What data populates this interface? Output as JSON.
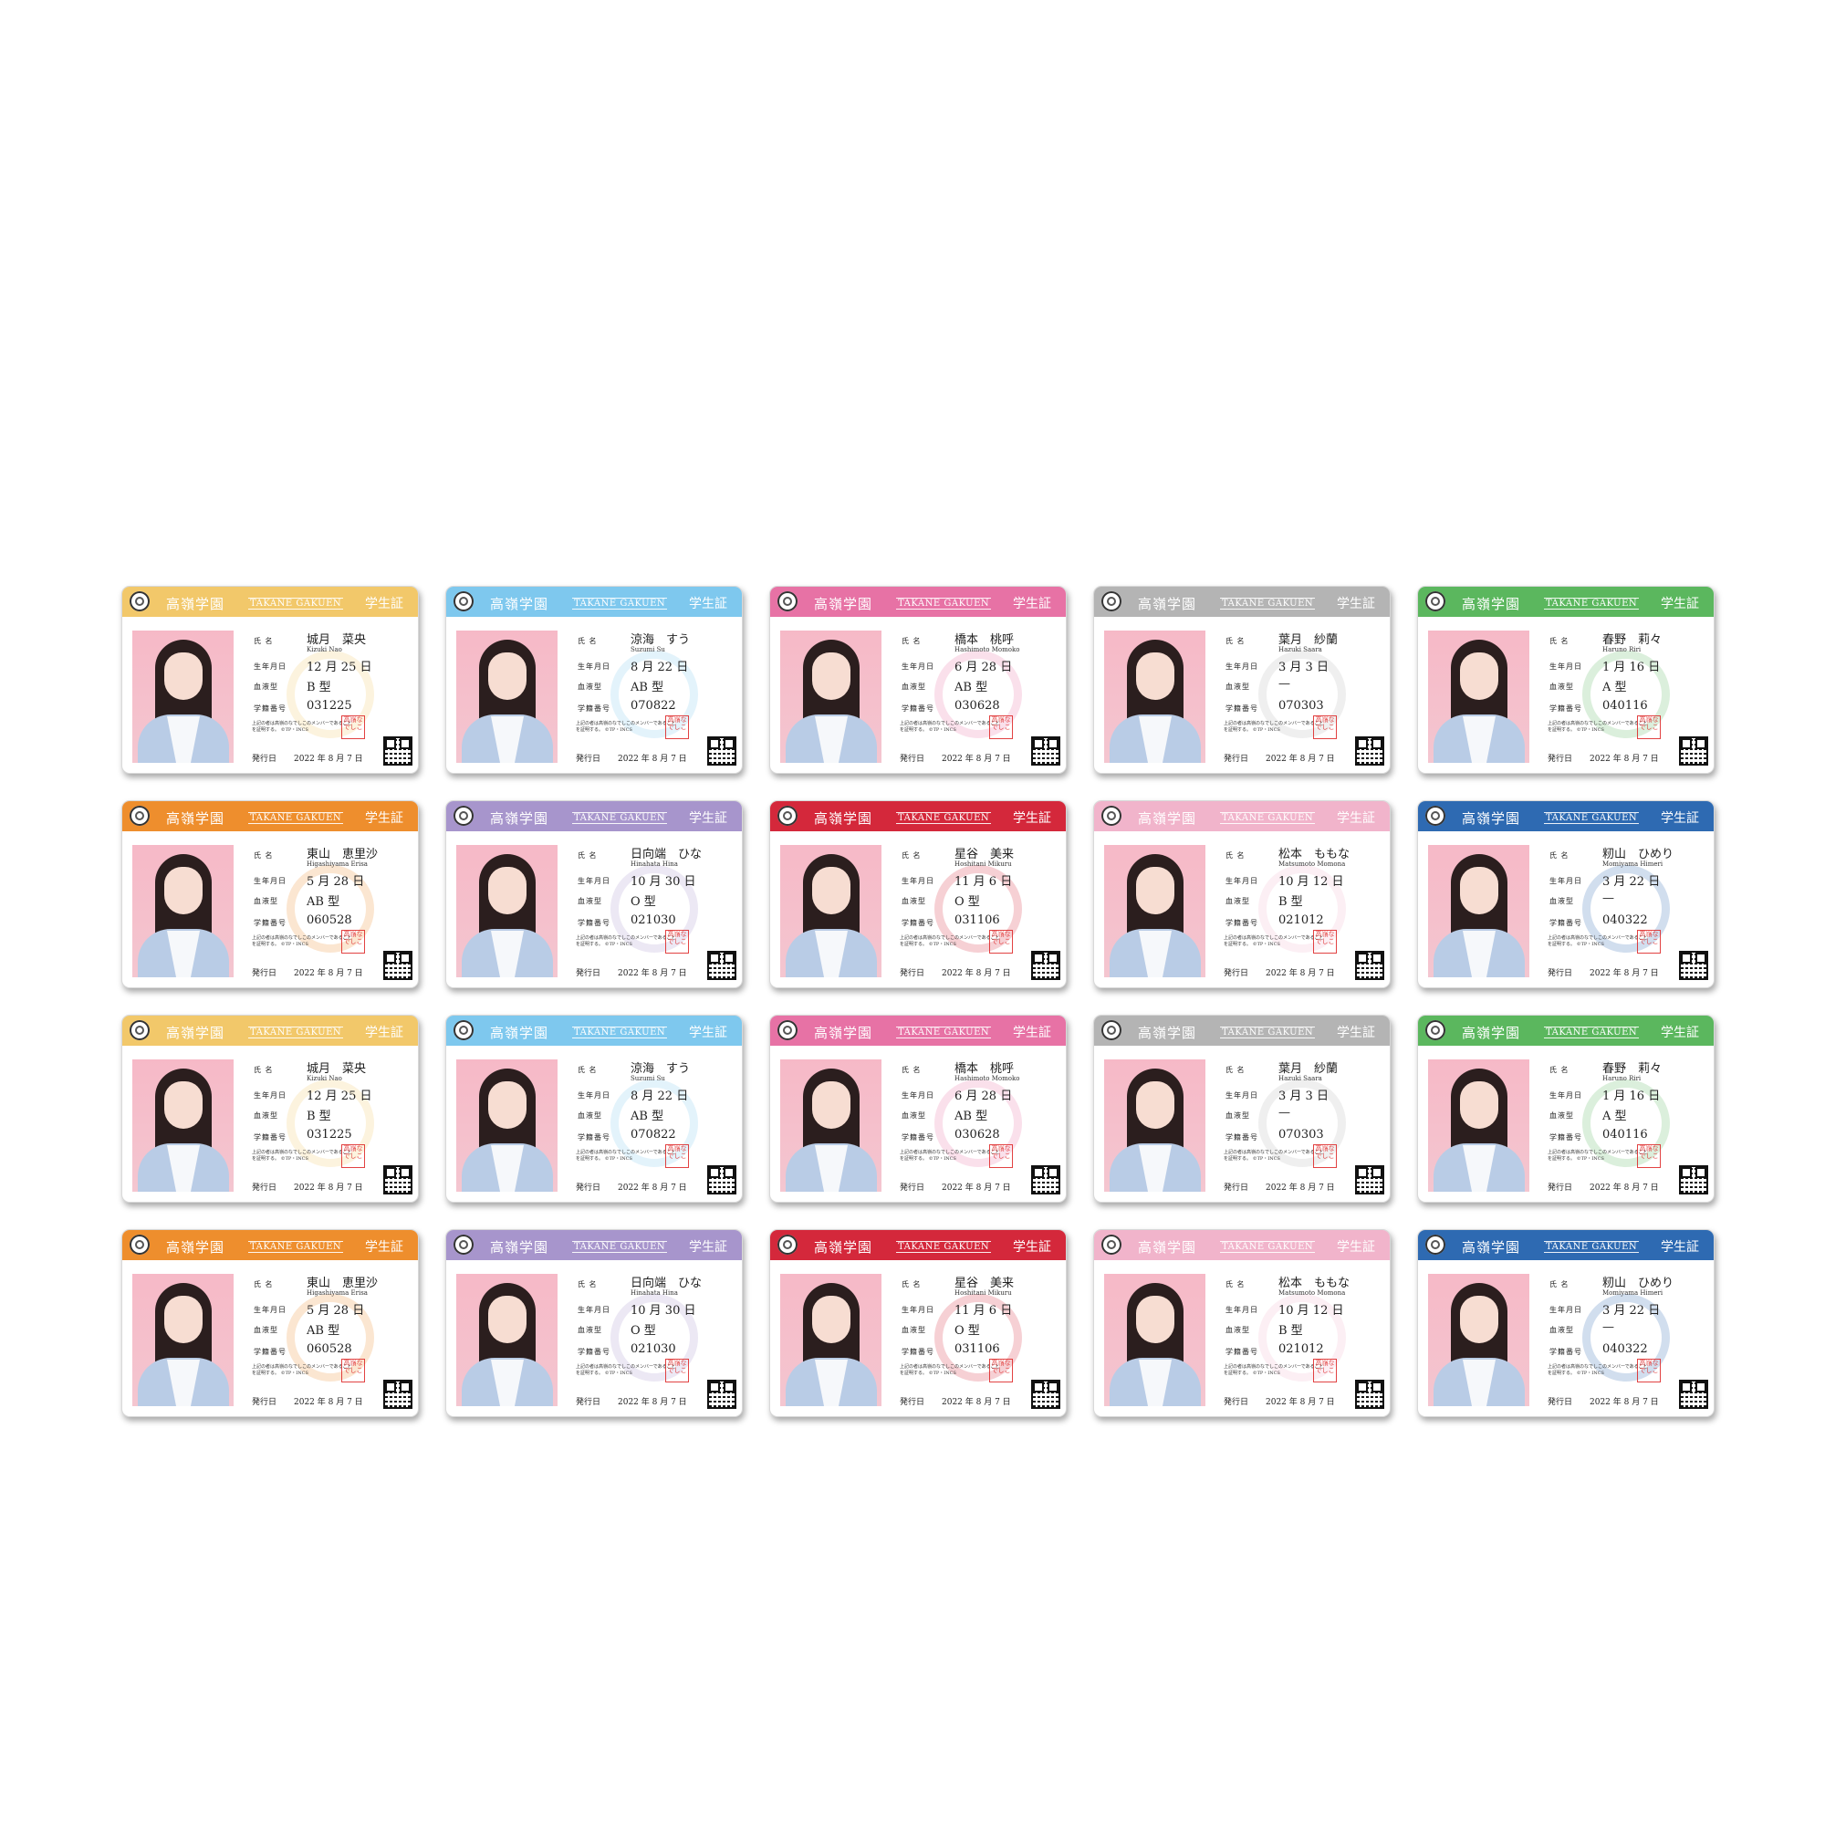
{
  "card_text": {
    "school": "高嶺学園",
    "school_roman": "TAKANE GAKUEN",
    "card_title": "学生証",
    "label_name": "氏 名",
    "label_birth": "生年月日",
    "label_blood": "血液型",
    "label_id": "学籍番号",
    "label_issue": "発行日",
    "issue_date": "2022 年 8 月 7 日",
    "note": "上記の者は高嶺のなでしこのメンバーであることを証明する。 ©TP・INCS",
    "stamp": "高嶺なでしこ"
  },
  "members": [
    {
      "name": "城月　菜央",
      "roman": "Kizuki Nao",
      "birth": "12 月 25 日",
      "blood": "B 型",
      "id": "031225",
      "color": "#f2c86a"
    },
    {
      "name": "涼海　すう",
      "roman": "Suzumi Su",
      "birth": "8 月 22 日",
      "blood": "AB 型",
      "id": "070822",
      "color": "#7ec8ee"
    },
    {
      "name": "橋本　桃呼",
      "roman": "Hashimoto Momoko",
      "birth": "6 月 28 日",
      "blood": "AB 型",
      "id": "030628",
      "color": "#e772a5"
    },
    {
      "name": "葉月　紗蘭",
      "roman": "Hazuki Saara",
      "birth": "3 月 3 日",
      "blood": "—",
      "id": "070303",
      "color": "#b4b4b4"
    },
    {
      "name": "春野　莉々",
      "roman": "Haruno Riri",
      "birth": "1 月 16 日",
      "blood": "A 型",
      "id": "040116",
      "color": "#5bb75e"
    },
    {
      "name": "東山　恵里沙",
      "roman": "Higashiyama Erisa",
      "birth": "5 月 28 日",
      "blood": "AB 型",
      "id": "060528",
      "color": "#ee8e2d"
    },
    {
      "name": "日向端　ひな",
      "roman": "Hinahata Hina",
      "birth": "10 月 30 日",
      "blood": "O 型",
      "id": "021030",
      "color": "#a795cc"
    },
    {
      "name": "星谷　美来",
      "roman": "Hoshitani Mikuru",
      "birth": "11 月 6 日",
      "blood": "O 型",
      "id": "031106",
      "color": "#d4283b"
    },
    {
      "name": "松本　ももな",
      "roman": "Matsumoto Momona",
      "birth": "10 月 12 日",
      "blood": "B 型",
      "id": "021012",
      "color": "#f1b4cb"
    },
    {
      "name": "籾山　ひめり",
      "roman": "Momiyama Himeri",
      "birth": "3 月 22 日",
      "blood": "—",
      "id": "040322",
      "color": "#2e6ab2"
    }
  ],
  "grid": {
    "rows": 4,
    "cols": 5
  }
}
